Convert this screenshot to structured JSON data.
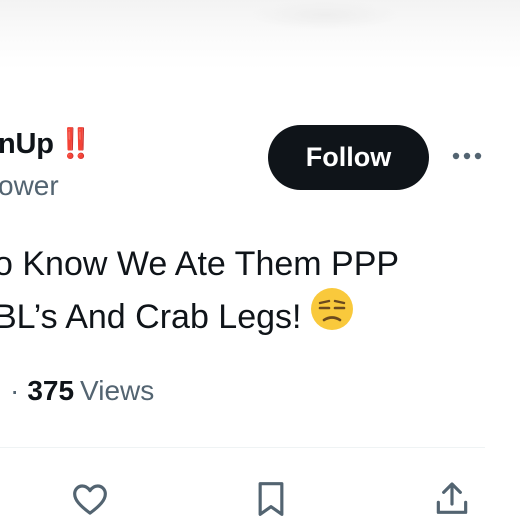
{
  "author": {
    "name": "nUp",
    "name_emoji": "‼️",
    "subtitle": "ower"
  },
  "follow_button": {
    "label": "Follow"
  },
  "more_button": {
    "icon": "more-horizontal-icon"
  },
  "tweet": {
    "lines": [
      "o Know We Ate Them PPP",
      "BL’s And Crab Legs!"
    ],
    "emoji_icon": "unamused-face-icon"
  },
  "stats": {
    "separator": "·",
    "views_count": "375",
    "views_label": "Views"
  },
  "actions": {
    "like_icon": "heart-icon",
    "bookmark_icon": "bookmark-icon",
    "share_icon": "share-icon"
  },
  "colors": {
    "text_primary": "#0f1419",
    "text_secondary": "#536471",
    "follow_bg": "#0f1419",
    "follow_text": "#ffffff",
    "emoji_red": "#d21f3c",
    "divider": "#eff3f4"
  }
}
